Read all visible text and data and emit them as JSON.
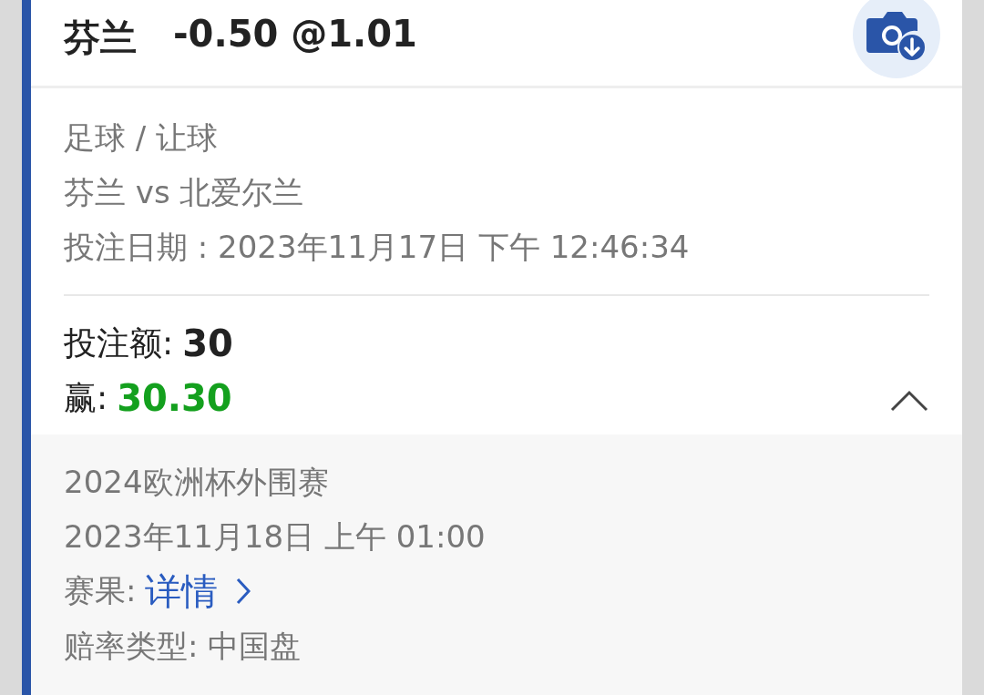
{
  "header": {
    "selection": "芬兰",
    "odds": "-0.50 @1.01"
  },
  "details": [
    "足球 / 让球",
    "芬兰 vs 北爱尔兰",
    "投注日期 : 2023年11月17日 下午 12:46:34"
  ],
  "stake": {
    "label": "投注额:",
    "value": "30"
  },
  "win": {
    "label": "赢:",
    "value": "30.30"
  },
  "expanded": true,
  "more": {
    "competition": "2024欧洲杯外围赛",
    "kickoff": "2023年11月18日 上午 01:00",
    "result_label": "赛果:",
    "result_link": "详情",
    "odds_type": "赔率类型: 中国盘"
  }
}
